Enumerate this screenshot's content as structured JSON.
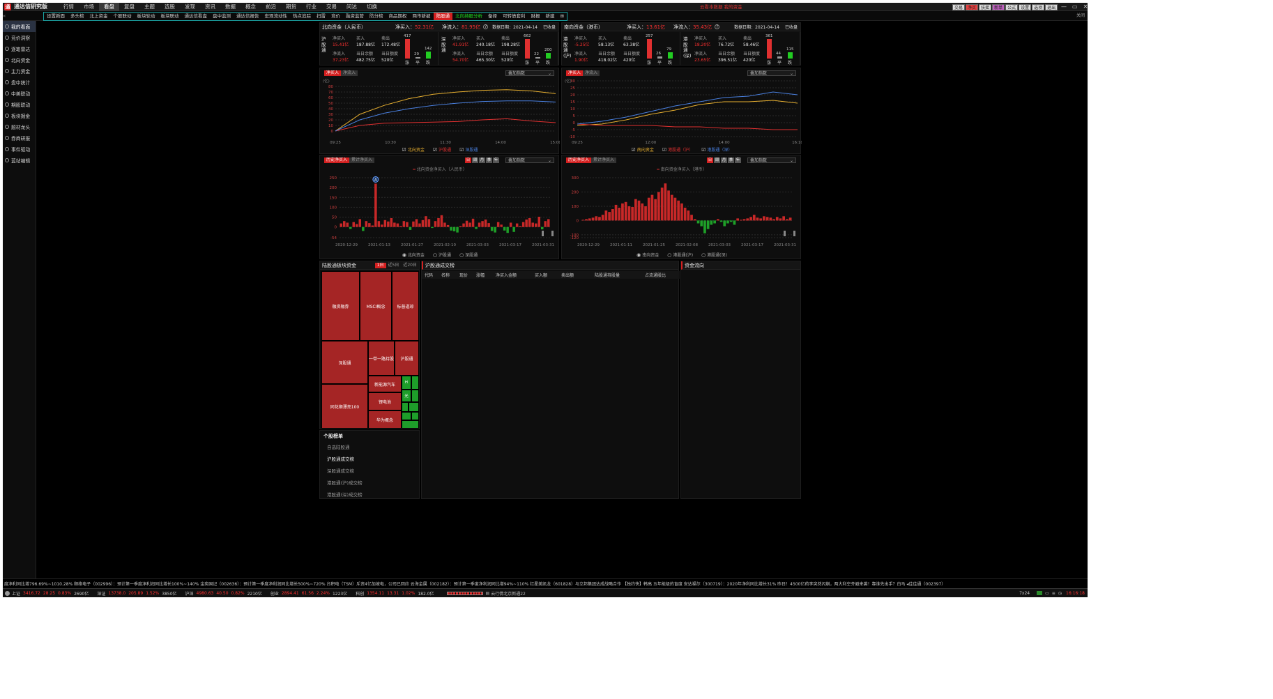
{
  "app": {
    "title": "通达信研究版",
    "logo": "通"
  },
  "mainmenu": [
    "行情",
    "市场",
    "看盘",
    "复盘",
    "主题",
    "选股",
    "发现",
    "资讯",
    "数据",
    "概念",
    "前沿",
    "期货",
    "行业",
    "交易",
    "问达",
    "切换"
  ],
  "mainmenu_active": 2,
  "top_links": "云看本数据  我的资金",
  "top_buttons": [
    "交易",
    "净买",
    "扶摇",
    "新单",
    "公式",
    "设置",
    "选项",
    "退出"
  ],
  "window_controls": [
    "—",
    "▭",
    "✕"
  ],
  "submenu": [
    "设置新面",
    "多头榜",
    "北上资金",
    "个股联动",
    "板块轮动",
    "板块联动",
    "通达信看盘",
    "盘中监测",
    "通达信报告",
    "宏观流动性",
    "热点追踪",
    "扫雷",
    "竞价",
    "融资监管",
    "防分榜",
    "商品期权",
    "两市新披",
    "陆股通",
    "北向持股分析",
    "备择",
    "可转债套利",
    "财报",
    "新建"
  ],
  "submenu_active": 17,
  "submenu_green": 18,
  "subbar_close": "关闭",
  "sidebar": [
    "我的看面",
    "竞价洞察",
    "逐笔雷达",
    "北向资金",
    "主力资金",
    "盘中统计",
    "中美联动",
    "期股联动",
    "板块掘金",
    "题材龙头",
    "券商研报",
    "事件驱动",
    "蓝站编辑"
  ],
  "north": {
    "title": "北向资金（人民币）",
    "net_label": "净买入：",
    "net_value": "52.31亿",
    "net2_label": "净流入：",
    "net2_value": "81.95亿",
    "date_label": "数据日期：2021-04-14",
    "status": "已收盘",
    "blocks": [
      {
        "side": "沪股通",
        "net": "15.41亿",
        "net_in": "37.23亿",
        "buy": "187.88亿",
        "sell": "172.48亿",
        "balance": "482.75亿",
        "quota": "520亿",
        "up": "417",
        "flat": "29",
        "down": "142"
      },
      {
        "side": "深股通",
        "net": "41.91亿",
        "net_in": "54.70亿",
        "buy": "240.18亿",
        "sell": "198.28亿",
        "balance": "465.30亿",
        "quota": "520亿",
        "up": "662",
        "flat": "22",
        "down": "200"
      }
    ]
  },
  "south": {
    "title": "南向资金（港币）",
    "net_label": "净买入：",
    "net_value": "13.61亿",
    "net2_label": "净流入：",
    "net2_value": "35.43亿",
    "date_label": "数据日期：2021-04-14",
    "status": "已收盘",
    "blocks": [
      {
        "side": "港股通(沪)",
        "net": "-5.25亿",
        "net_in": "1.90亿",
        "buy": "58.13亿",
        "sell": "63.38亿",
        "balance": "418.02亿",
        "quota": "420亿",
        "up": "257",
        "flat": "26",
        "down": "79"
      },
      {
        "side": "港股通(深)",
        "net": "18.20亿",
        "net_in": "23.65亿",
        "buy": "76.72亿",
        "sell": "58.46亿",
        "balance": "396.51亿",
        "quota": "420亿",
        "up": "361",
        "flat": "44",
        "down": "115"
      }
    ]
  },
  "labels": {
    "net": "净买入",
    "net_in": "净流入",
    "buy": "买入",
    "sell": "卖出",
    "balance": "当日余额",
    "quota": "当日额度",
    "up": "涨",
    "flat": "平",
    "down": "跌"
  },
  "intraday_tabs": [
    "净买入",
    "净流入"
  ],
  "history_tabs": [
    "历史净买入",
    "累计净买入"
  ],
  "overlay_select": "叠加指数",
  "period_buttons": [
    "日",
    "周",
    "月",
    "季",
    "年"
  ],
  "chart_data": [
    {
      "type": "line",
      "id": "north-intraday",
      "ylabel": "(亿)",
      "ylim": [
        -10,
        90
      ],
      "yticks": [
        0,
        10,
        20,
        30,
        40,
        50,
        60,
        70,
        80
      ],
      "x": [
        "09:25",
        "10:30",
        "11:30",
        "14:00",
        "15:00"
      ],
      "series": [
        {
          "name": "北向资金",
          "color": "#e8b030",
          "values": [
            0,
            30,
            46,
            58,
            66,
            70,
            73,
            74,
            72,
            67
          ]
        },
        {
          "name": "沪股通",
          "color": "#e03030",
          "values": [
            0,
            10,
            14,
            15,
            16,
            17,
            20,
            22,
            18,
            15
          ]
        },
        {
          "name": "深股通",
          "color": "#4a80e0",
          "values": [
            0,
            20,
            32,
            40,
            46,
            50,
            53,
            54,
            54,
            52
          ]
        }
      ]
    },
    {
      "type": "line",
      "id": "south-intraday",
      "ylabel": "(亿)",
      "ylim": [
        -10,
        30
      ],
      "yticks": [
        -10,
        -5,
        0,
        5,
        10,
        15,
        20,
        25,
        30
      ],
      "x": [
        "09:25",
        "12:00",
        "14:00",
        "16:10"
      ],
      "series": [
        {
          "name": "南向资金",
          "color": "#e8b030",
          "values": [
            -2,
            -1,
            2,
            6,
            9,
            13,
            15,
            15,
            16,
            14
          ]
        },
        {
          "name": "港股通（沪）",
          "color": "#e03030",
          "values": [
            -1,
            -2,
            -2,
            -2,
            -3,
            -3,
            -4,
            -4,
            -5,
            -5
          ]
        },
        {
          "name": "港股通（深）",
          "color": "#4a80e0",
          "values": [
            -1,
            1,
            4,
            8,
            12,
            15,
            18,
            19,
            22,
            20
          ]
        }
      ]
    },
    {
      "type": "bar",
      "id": "north-history",
      "legend": "北向资金净买入（人民币）",
      "ylim": [
        -54,
        250
      ],
      "yticks": [
        -54,
        0,
        50,
        100,
        150,
        200,
        250
      ],
      "x": [
        "2020-12-29",
        "2021-01-13",
        "2021-01-27",
        "2021-02-10",
        "2021-03-03",
        "2021-03-17",
        "2021-03-31"
      ],
      "values": [
        18,
        30,
        22,
        -10,
        25,
        15,
        40,
        -20,
        30,
        20,
        8,
        220,
        30,
        12,
        35,
        28,
        45,
        22,
        18,
        5,
        30,
        25,
        -15,
        28,
        40,
        18,
        35,
        55,
        40,
        -5,
        30,
        45,
        60,
        22,
        10,
        -18,
        -22,
        -28,
        5,
        18,
        32,
        22,
        42,
        -10,
        22,
        30,
        38,
        20,
        -20,
        -28,
        25,
        12,
        -18,
        -30,
        22,
        -25,
        18,
        5,
        25,
        38,
        45,
        22,
        18,
        52,
        -12,
        30,
        40
      ]
    },
    {
      "type": "bar",
      "id": "south-history",
      "legend": "南向资金净买入（港币）",
      "ylim": [
        -120,
        300
      ],
      "yticks": [
        -120,
        -100,
        0,
        100,
        200,
        300
      ],
      "x": [
        "2020-12-29",
        "2021-01-11",
        "2021-01-25",
        "2021-02-08",
        "2021-03-03",
        "2021-03-17",
        "2021-03-31"
      ],
      "values": [
        5,
        10,
        15,
        20,
        30,
        25,
        40,
        70,
        60,
        80,
        110,
        90,
        120,
        130,
        100,
        95,
        150,
        140,
        120,
        100,
        160,
        180,
        150,
        200,
        230,
        260,
        210,
        180,
        160,
        140,
        120,
        90,
        70,
        40,
        10,
        -20,
        -40,
        -90,
        -60,
        -30,
        -20,
        10,
        -10,
        -40,
        -20,
        -10,
        -30,
        15,
        5,
        10,
        15,
        25,
        40,
        20,
        15,
        30,
        25,
        20,
        10,
        25,
        15,
        30,
        10,
        20
      ]
    }
  ],
  "north_legend": [
    "北向资金",
    "沪股通",
    "深股通"
  ],
  "south_legend": [
    "南向资金",
    "港股通（沪）",
    "港股通（深）"
  ],
  "north_hist_radio": [
    "北向资金",
    "沪股通",
    "深股通"
  ],
  "south_hist_radio": [
    "南向资金",
    "港股通(沪)",
    "港股通(深)"
  ],
  "history_marker": "A",
  "sector": {
    "title": "陆股通板块资金",
    "tabs": [
      "1日",
      "近5日",
      "近20日"
    ]
  },
  "tiles": {
    "red": [
      "融资融券",
      "MSCI概念",
      "标普道琼",
      "深股通",
      "一带一路持股",
      "沪股通",
      "新能源汽车",
      "同花顺漂亮100",
      "锂电池",
      "华为概念"
    ],
    "green": [
      "H",
      "光"
    ]
  },
  "table": {
    "title": "沪股通成交榜",
    "columns": [
      "代码",
      "名称",
      "现价",
      "涨幅",
      "净买入金额",
      "买入额",
      "卖出额",
      "陆股通持股量",
      "占流通股比"
    ]
  },
  "right_panel_title": "资金流向",
  "ranking": {
    "title": "个股榜单",
    "items": [
      "自选陆股通",
      "沪股通成交榜",
      "深股通成交榜",
      "港股通(沪)成交榜",
      "港股通(深)成交榜"
    ]
  },
  "ticker": "度净利同比增796.69%~1010.28%    顺络电子（002996）：预计第一季度净利润同比增长100%~140%    金奕国记（002636）：预计第一季度净利润同比增长500%~720%    台积电（TSM）斥资4亿加坡电，公司已回应    云海金属（002182）：预计第一季度净利润同比增94%~110%    红星美凯龙（601828）与立邦集团达成战略合作    【独约快】韩高 五年能级的盲度    安达福尔（300719）：2020年净利同比增长31%    昨日！4500亿药李突然闪崩，两大利空齐避来袭！靠谁先出手？白马    ◂佳佳通（002397）",
  "statusbar": {
    "segments": [
      {
        "label": "上证",
        "value": "3416.72",
        "chg": "28.25",
        "pct": "0.83%",
        "amt": "2690亿"
      },
      {
        "label": "深证",
        "value": "13738.0",
        "chg": "205.89",
        "pct": "1.52%",
        "amt": "3850亿"
      },
      {
        "label": "沪深",
        "value": "4980.63",
        "chg": "40.50",
        "pct": "0.82%",
        "amt": "2210亿"
      },
      {
        "label": "创业",
        "value": "2894.41",
        "chg": "61.56",
        "pct": "2.24%",
        "amt": "1223亿"
      },
      {
        "label": "科创",
        "value": "1354.11",
        "chg": "13.31",
        "pct": "1.02%",
        "amt": "182.0亿"
      }
    ],
    "server": "云行情北京新通22",
    "mode": "7x24",
    "clock": "16:16:18"
  }
}
